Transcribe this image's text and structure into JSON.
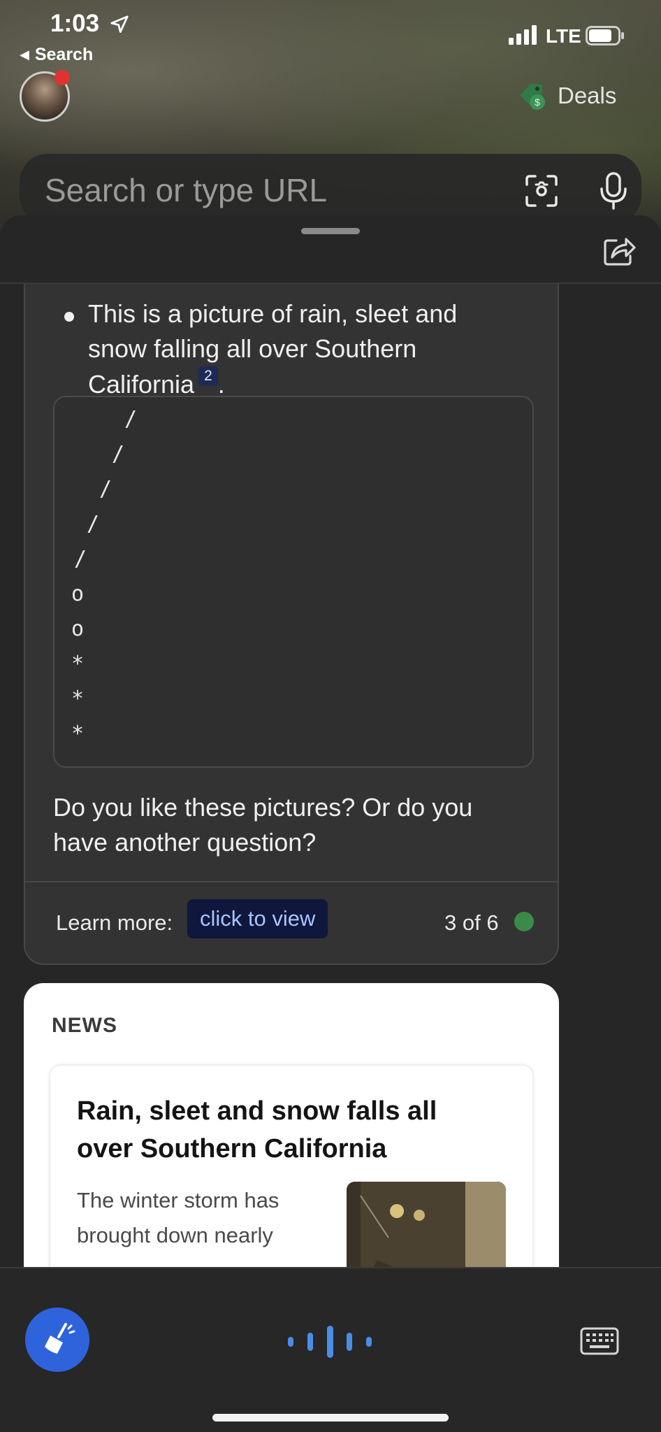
{
  "status_bar": {
    "time": "1:03",
    "back_label": "Search",
    "network": "LTE"
  },
  "header": {
    "deals_label": "Deals"
  },
  "search": {
    "placeholder": "Search or type URL"
  },
  "chat": {
    "bullet_text": "This is a picture of rain, sleet and snow falling all over Southern California",
    "citation": "2",
    "bullet_end": ".",
    "code_lines": [
      "/",
      "/",
      "/",
      "/",
      "/",
      "o",
      "o",
      "*",
      "*",
      "*"
    ],
    "question": "Do you like these pictures? Or do you have another question?",
    "learn_more_label": "Learn more:",
    "learn_more_button": "click to view",
    "counter": "3 of 6"
  },
  "news": {
    "heading": "NEWS",
    "title": "Rain, sleet and snow falls all over Southern California",
    "snippet": "The winter storm has brought down nearly"
  },
  "colors": {
    "accent_blue": "#2e63dc",
    "status_green": "#3c8a48",
    "citation_bg": "#1e2a55"
  }
}
